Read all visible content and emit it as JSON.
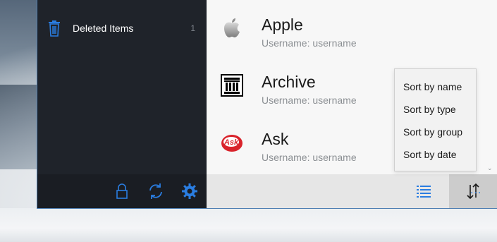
{
  "sidebar": {
    "items": [
      {
        "label": "Deleted Items",
        "count": "1",
        "icon": "trash-icon"
      }
    ],
    "toolbar": {
      "icons": [
        "lock-icon",
        "sync-icon",
        "gear-icon"
      ]
    }
  },
  "entries": [
    {
      "title": "Apple",
      "username_label": "Username:",
      "username": "username",
      "icon": "apple-logo-icon"
    },
    {
      "title": "Archive",
      "username_label": "Username:",
      "username": "username",
      "icon": "archive-logo-icon"
    },
    {
      "title": "Ask",
      "username_label": "Username:",
      "username": "username",
      "icon": "ask-logo-icon"
    }
  ],
  "ask_logo_text": "Ask",
  "sort_menu": {
    "items": [
      "Sort by name",
      "Sort by type",
      "Sort by group",
      "Sort by date"
    ]
  },
  "command_bar": {
    "icons": [
      "list-view-icon",
      "sort-icon",
      "more-icon"
    ],
    "more_label": "..."
  },
  "colors": {
    "accent": "#2a7de1",
    "sidebar_bg": "#1f232a",
    "ask_red": "#d9232b"
  }
}
